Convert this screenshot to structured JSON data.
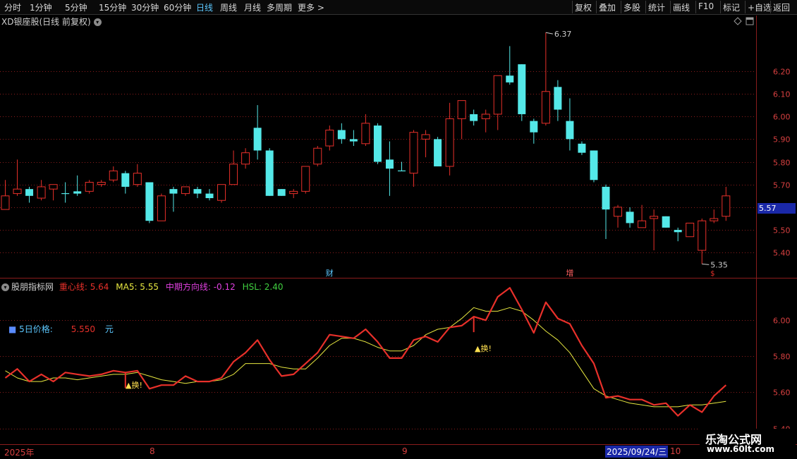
{
  "toolbar": {
    "timeframes": [
      "分时",
      "1分钟",
      "5分钟",
      "15分钟",
      "30分钟",
      "60分钟",
      "日线",
      "周线",
      "月线",
      "多周期",
      "更多 >"
    ],
    "active": "日线",
    "tools": [
      "复权",
      "叠加",
      "多股",
      "统计",
      "画线",
      "F10",
      "标记",
      "+自选",
      "返回"
    ]
  },
  "chart_header": {
    "title": "XD银座股(日线 前复权)"
  },
  "price_axis": {
    "ticks": [
      "6.20",
      "6.10",
      "6.00",
      "5.90",
      "5.80",
      "5.70",
      "5.60",
      "5.50",
      "5.40"
    ],
    "current_price": "5.57"
  },
  "annotations": {
    "high": "6.37",
    "low": "5.35",
    "marker_cai": "财",
    "marker_zeng": "增",
    "marker_s": "$"
  },
  "indicator": {
    "name": "股朋指标网",
    "label_zhongxin": "重心线: 5.64",
    "label_ma5": "MA5: 5.55",
    "label_zhongqi": "中期方向线: -0.12",
    "label_hsl": "HSL: 2.40",
    "five_day_label": "5日价格:",
    "five_day_value": "5.550",
    "five_day_unit": "元",
    "signal": "▲换!",
    "axis_ticks": [
      "6.00",
      "5.80",
      "5.60",
      "5.40"
    ]
  },
  "date_axis": {
    "labels": [
      "2025年",
      "8",
      "9",
      "10"
    ],
    "cursor_date": "2025/09/24/三"
  },
  "watermark": {
    "line1": "乐淘公式网",
    "line2": "www.60lt.com"
  },
  "colors": {
    "up": "#e8302a",
    "down": "#54e8e8",
    "ma5": "#e8e840",
    "grid": "#8a1c1c",
    "active_tab": "#5cc8ff"
  },
  "chart_data": {
    "type": "candlestick",
    "y_range": [
      5.32,
      6.42
    ],
    "candles": [
      {
        "o": 5.59,
        "c": 5.65,
        "h": 5.72,
        "l": 5.59,
        "dir": "up"
      },
      {
        "o": 5.66,
        "c": 5.68,
        "h": 5.81,
        "l": 5.65,
        "dir": "up"
      },
      {
        "o": 5.68,
        "c": 5.65,
        "h": 5.69,
        "l": 5.62,
        "dir": "down"
      },
      {
        "o": 5.64,
        "c": 5.69,
        "h": 5.72,
        "l": 5.63,
        "dir": "up"
      },
      {
        "o": 5.68,
        "c": 5.7,
        "h": 5.7,
        "l": 5.63,
        "dir": "up"
      },
      {
        "o": 5.66,
        "c": 5.66,
        "h": 5.71,
        "l": 5.62,
        "dir": "down"
      },
      {
        "o": 5.67,
        "c": 5.66,
        "h": 5.74,
        "l": 5.65,
        "dir": "down"
      },
      {
        "o": 5.67,
        "c": 5.71,
        "h": 5.72,
        "l": 5.66,
        "dir": "up"
      },
      {
        "o": 5.7,
        "c": 5.71,
        "h": 5.72,
        "l": 5.69,
        "dir": "up"
      },
      {
        "o": 5.72,
        "c": 5.76,
        "h": 5.78,
        "l": 5.71,
        "dir": "up"
      },
      {
        "o": 5.75,
        "c": 5.69,
        "h": 5.76,
        "l": 5.66,
        "dir": "down"
      },
      {
        "o": 5.7,
        "c": 5.75,
        "h": 5.79,
        "l": 5.69,
        "dir": "up"
      },
      {
        "o": 5.71,
        "c": 5.54,
        "h": 5.71,
        "l": 5.53,
        "dir": "down"
      },
      {
        "o": 5.54,
        "c": 5.65,
        "h": 5.66,
        "l": 5.54,
        "dir": "up"
      },
      {
        "o": 5.68,
        "c": 5.66,
        "h": 5.69,
        "l": 5.58,
        "dir": "down"
      },
      {
        "o": 5.66,
        "c": 5.69,
        "h": 5.69,
        "l": 5.65,
        "dir": "up"
      },
      {
        "o": 5.68,
        "c": 5.66,
        "h": 5.69,
        "l": 5.64,
        "dir": "down"
      },
      {
        "o": 5.66,
        "c": 5.64,
        "h": 5.68,
        "l": 5.63,
        "dir": "down"
      },
      {
        "o": 5.63,
        "c": 5.7,
        "h": 5.7,
        "l": 5.62,
        "dir": "up"
      },
      {
        "o": 5.7,
        "c": 5.79,
        "h": 5.85,
        "l": 5.7,
        "dir": "up"
      },
      {
        "o": 5.79,
        "c": 5.84,
        "h": 5.86,
        "l": 5.77,
        "dir": "up"
      },
      {
        "o": 5.95,
        "c": 5.85,
        "h": 6.05,
        "l": 5.81,
        "dir": "down"
      },
      {
        "o": 5.85,
        "c": 5.65,
        "h": 5.86,
        "l": 5.65,
        "dir": "down"
      },
      {
        "o": 5.68,
        "c": 5.65,
        "h": 5.68,
        "l": 5.65,
        "dir": "down"
      },
      {
        "o": 5.66,
        "c": 5.67,
        "h": 5.68,
        "l": 5.64,
        "dir": "up"
      },
      {
        "o": 5.67,
        "c": 5.78,
        "h": 5.78,
        "l": 5.66,
        "dir": "up"
      },
      {
        "o": 5.79,
        "c": 5.86,
        "h": 5.87,
        "l": 5.78,
        "dir": "up"
      },
      {
        "o": 5.87,
        "c": 5.94,
        "h": 5.96,
        "l": 5.85,
        "dir": "up"
      },
      {
        "o": 5.94,
        "c": 5.9,
        "h": 5.97,
        "l": 5.88,
        "dir": "down"
      },
      {
        "o": 5.9,
        "c": 5.89,
        "h": 5.94,
        "l": 5.87,
        "dir": "down"
      },
      {
        "o": 5.88,
        "c": 5.97,
        "h": 6.01,
        "l": 5.87,
        "dir": "up"
      },
      {
        "o": 5.96,
        "c": 5.8,
        "h": 5.97,
        "l": 5.79,
        "dir": "down"
      },
      {
        "o": 5.81,
        "c": 5.77,
        "h": 5.89,
        "l": 5.65,
        "dir": "down"
      },
      {
        "o": 5.76,
        "c": 5.76,
        "h": 5.8,
        "l": 5.76,
        "dir": "down"
      },
      {
        "o": 5.75,
        "c": 5.93,
        "h": 5.94,
        "l": 5.69,
        "dir": "up"
      },
      {
        "o": 5.9,
        "c": 5.92,
        "h": 5.94,
        "l": 5.82,
        "dir": "up"
      },
      {
        "o": 5.9,
        "c": 5.78,
        "h": 5.91,
        "l": 5.78,
        "dir": "down"
      },
      {
        "o": 5.78,
        "c": 5.99,
        "h": 6.06,
        "l": 5.74,
        "dir": "up"
      },
      {
        "o": 5.99,
        "c": 6.07,
        "h": 6.07,
        "l": 5.9,
        "dir": "up"
      },
      {
        "o": 6.01,
        "c": 5.98,
        "h": 6.03,
        "l": 5.96,
        "dir": "down"
      },
      {
        "o": 5.99,
        "c": 6.01,
        "h": 6.03,
        "l": 5.93,
        "dir": "up"
      },
      {
        "o": 6.01,
        "c": 6.18,
        "h": 6.18,
        "l": 5.94,
        "dir": "up"
      },
      {
        "o": 6.18,
        "c": 6.15,
        "h": 6.31,
        "l": 6.14,
        "dir": "down"
      },
      {
        "o": 6.23,
        "c": 6.01,
        "h": 6.23,
        "l": 5.98,
        "dir": "down"
      },
      {
        "o": 5.98,
        "c": 5.93,
        "h": 5.99,
        "l": 5.88,
        "dir": "down"
      },
      {
        "o": 5.97,
        "c": 6.11,
        "h": 6.37,
        "l": 5.96,
        "dir": "up"
      },
      {
        "o": 6.13,
        "c": 6.03,
        "h": 6.16,
        "l": 5.98,
        "dir": "down"
      },
      {
        "o": 5.98,
        "c": 5.9,
        "h": 6.08,
        "l": 5.85,
        "dir": "down"
      },
      {
        "o": 5.88,
        "c": 5.84,
        "h": 5.89,
        "l": 5.83,
        "dir": "down"
      },
      {
        "o": 5.85,
        "c": 5.72,
        "h": 5.85,
        "l": 5.71,
        "dir": "down"
      },
      {
        "o": 5.69,
        "c": 5.59,
        "h": 5.7,
        "l": 5.46,
        "dir": "down"
      },
      {
        "o": 5.56,
        "c": 5.6,
        "h": 5.61,
        "l": 5.51,
        "dir": "up"
      },
      {
        "o": 5.58,
        "c": 5.53,
        "h": 5.6,
        "l": 5.51,
        "dir": "down"
      },
      {
        "o": 5.51,
        "c": 5.54,
        "h": 5.61,
        "l": 5.51,
        "dir": "up"
      },
      {
        "o": 5.55,
        "c": 5.56,
        "h": 5.59,
        "l": 5.41,
        "dir": "up"
      },
      {
        "o": 5.56,
        "c": 5.51,
        "h": 5.56,
        "l": 5.51,
        "dir": "down"
      },
      {
        "o": 5.5,
        "c": 5.49,
        "h": 5.51,
        "l": 5.45,
        "dir": "down"
      },
      {
        "o": 5.47,
        "c": 5.53,
        "h": 5.53,
        "l": 5.47,
        "dir": "up"
      },
      {
        "o": 5.41,
        "c": 5.54,
        "h": 5.55,
        "l": 5.35,
        "dir": "up"
      },
      {
        "o": 5.54,
        "c": 5.55,
        "h": 5.59,
        "l": 5.53,
        "dir": "up"
      },
      {
        "o": 5.56,
        "c": 5.65,
        "h": 5.69,
        "l": 5.54,
        "dir": "up"
      }
    ],
    "indicator_range": [
      5.32,
      6.22
    ],
    "zhongxin": [
      5.68,
      5.73,
      5.66,
      5.7,
      5.66,
      5.71,
      5.7,
      5.69,
      5.7,
      5.72,
      5.71,
      5.72,
      5.62,
      5.64,
      5.64,
      5.69,
      5.66,
      5.66,
      5.68,
      5.77,
      5.82,
      5.89,
      5.78,
      5.69,
      5.7,
      5.76,
      5.82,
      5.92,
      5.91,
      5.9,
      5.95,
      5.88,
      5.79,
      5.79,
      5.89,
      5.91,
      5.88,
      5.96,
      5.97,
      6.02,
      6.0,
      6.13,
      6.18,
      6.06,
      5.93,
      6.1,
      6.01,
      5.98,
      5.86,
      5.76,
      5.57,
      5.58,
      5.56,
      5.56,
      5.53,
      5.54,
      5.47,
      5.53,
      5.49,
      5.58,
      5.64
    ],
    "ma5": [
      5.72,
      5.68,
      5.66,
      5.66,
      5.68,
      5.68,
      5.67,
      5.68,
      5.69,
      5.7,
      5.7,
      5.71,
      5.69,
      5.67,
      5.66,
      5.65,
      5.66,
      5.66,
      5.67,
      5.7,
      5.76,
      5.76,
      5.76,
      5.74,
      5.73,
      5.73,
      5.79,
      5.86,
      5.9,
      5.9,
      5.88,
      5.85,
      5.83,
      5.83,
      5.86,
      5.92,
      5.95,
      5.96,
      6.01,
      6.07,
      6.05,
      6.05,
      6.07,
      6.05,
      6.0,
      5.94,
      5.89,
      5.82,
      5.72,
      5.62,
      5.58,
      5.56,
      5.54,
      5.53,
      5.52,
      5.52,
      5.52,
      5.53,
      5.53,
      5.54,
      5.55
    ]
  }
}
